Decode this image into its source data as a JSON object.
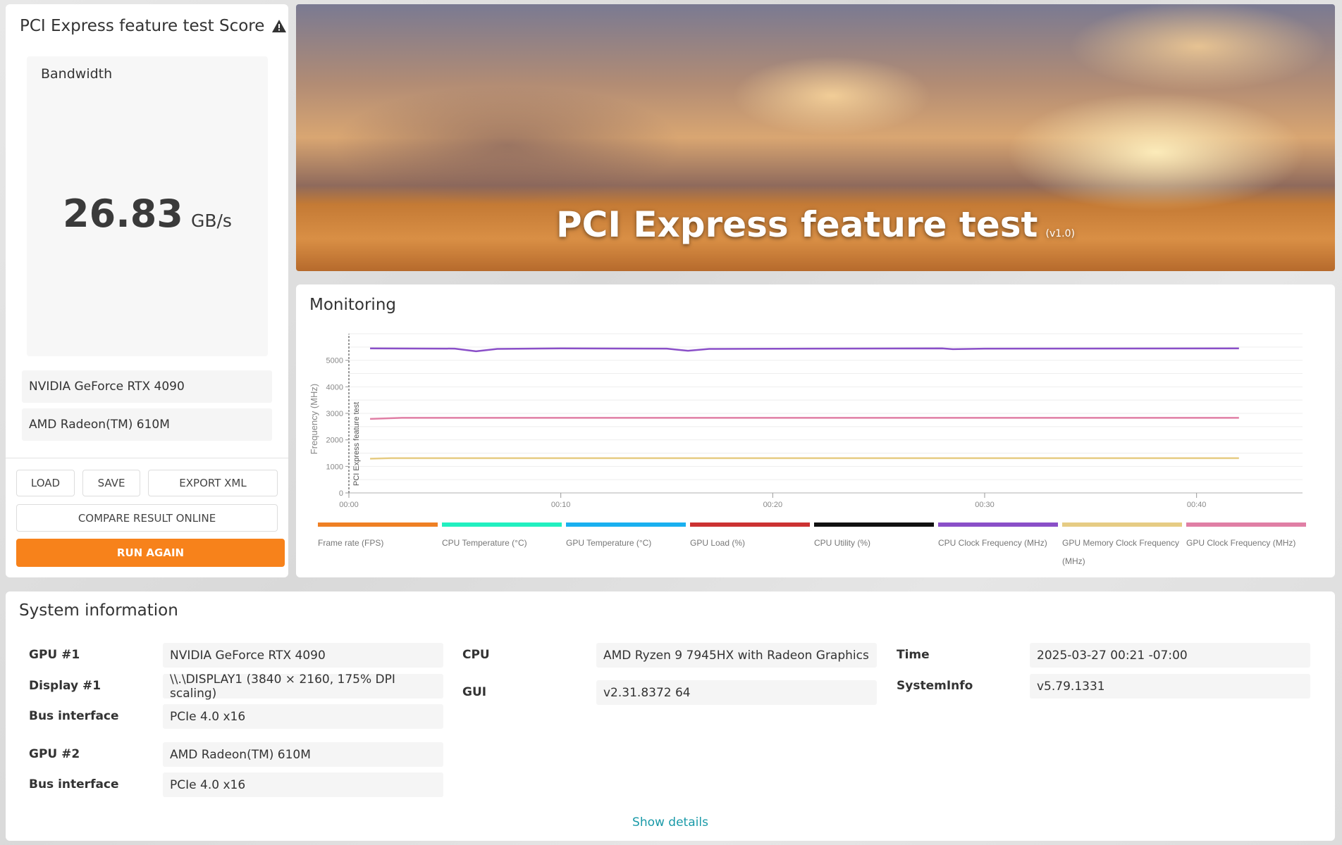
{
  "score_panel": {
    "title": "PCI Express feature test Score",
    "warning_icon": "warning-triangle-icon",
    "metric_label": "Bandwidth",
    "value": "26.83",
    "unit": "GB/s",
    "gpus": [
      "NVIDIA GeForce RTX 4090",
      "AMD Radeon(TM) 610M"
    ],
    "buttons": {
      "load": "LOAD",
      "save": "SAVE",
      "export": "EXPORT XML",
      "compare": "COMPARE RESULT ONLINE",
      "run_again": "RUN AGAIN"
    },
    "accent": "#f7821b"
  },
  "banner": {
    "title": "PCI Express feature test",
    "version": "(v1.0)"
  },
  "monitoring": {
    "title": "Monitoring"
  },
  "chart_data": {
    "type": "line",
    "ylabel": "Frequency (MHz)",
    "marker_label": "PCI Express feature test",
    "xlim": [
      0,
      45
    ],
    "ylim": [
      0,
      6000
    ],
    "yticks": [
      "0",
      "1000",
      "2000",
      "3000",
      "4000",
      "5000"
    ],
    "ytick_values": [
      0,
      1000,
      2000,
      3000,
      4000,
      5000
    ],
    "xticks": [
      "00:00",
      "00:10",
      "00:20",
      "00:30",
      "00:40"
    ],
    "xtick_values": [
      0,
      10,
      20,
      30,
      40
    ],
    "series": [
      {
        "name": "Frame rate (FPS)",
        "color": "#ef8024",
        "points": []
      },
      {
        "name": "CPU Temperature (°C)",
        "color": "#21f0c0",
        "points": []
      },
      {
        "name": "GPU Temperature (°C)",
        "color": "#1ab0f0",
        "points": []
      },
      {
        "name": "GPU Load (%)",
        "color": "#cc3232",
        "points": []
      },
      {
        "name": "CPU Utility (%)",
        "color": "#111111",
        "points": []
      },
      {
        "name": "CPU Clock Frequency (MHz)",
        "color": "#8a4fc8",
        "points": [
          [
            1,
            5450
          ],
          [
            5,
            5440
          ],
          [
            6,
            5340
          ],
          [
            7,
            5430
          ],
          [
            10,
            5450
          ],
          [
            15,
            5440
          ],
          [
            16,
            5360
          ],
          [
            17,
            5430
          ],
          [
            28,
            5450
          ],
          [
            28.5,
            5420
          ],
          [
            30,
            5440
          ],
          [
            42,
            5450
          ]
        ]
      },
      {
        "name": "GPU Memory Clock Frequency (MHz)",
        "color": "#e6cc84",
        "points": [
          [
            1,
            1290
          ],
          [
            2,
            1310
          ],
          [
            42,
            1310
          ]
        ]
      },
      {
        "name": "GPU Clock Frequency (MHz)",
        "color": "#e07fa5",
        "points": [
          [
            1,
            2790
          ],
          [
            2.5,
            2830
          ],
          [
            42,
            2830
          ]
        ]
      }
    ]
  },
  "system_info": {
    "title": "System information",
    "col1": [
      {
        "label": "GPU #1",
        "value": "NVIDIA GeForce RTX 4090"
      },
      {
        "label": "Display #1",
        "value": "\\\\.\\DISPLAY1 (3840 × 2160, 175% DPI scaling)"
      },
      {
        "label": "Bus interface",
        "value": "PCIe 4.0 x16"
      },
      {
        "label": "GPU #2",
        "value": "AMD Radeon(TM) 610M"
      },
      {
        "label": "Bus interface",
        "value": "PCIe 4.0 x16"
      }
    ],
    "col2": [
      {
        "label": "CPU",
        "value": "AMD Ryzen 9 7945HX with Radeon Graphics"
      },
      {
        "label": "GUI",
        "value": "v2.31.8372 64"
      }
    ],
    "col3": [
      {
        "label": "Time",
        "value": "2025-03-27 00:21 -07:00"
      },
      {
        "label": "SystemInfo",
        "value": "v5.79.1331"
      }
    ],
    "show_details": "Show details",
    "link_color": "#1a9aa8"
  }
}
